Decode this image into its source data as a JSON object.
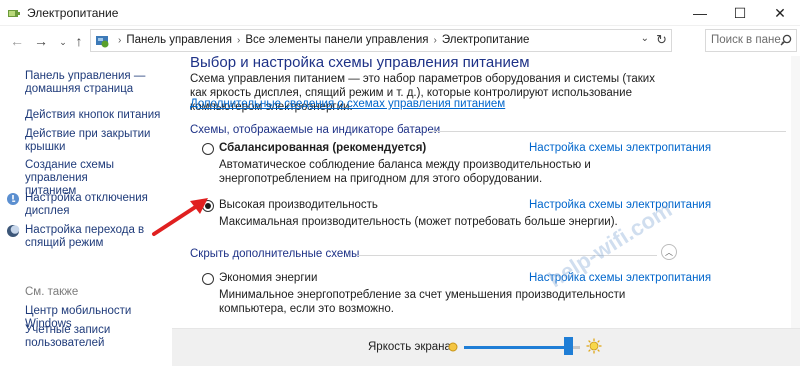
{
  "window": {
    "title": "Электропитание",
    "minimize": "—",
    "maximize": "☐",
    "close": "✕"
  },
  "nav": {
    "back": "←",
    "forward": "→",
    "dropdown": "⌄",
    "up": "↑",
    "breadcrumbs": [
      "Панель управления",
      "Все элементы панели управления",
      "Электропитание"
    ],
    "separator": "›",
    "address_drop": "⌄",
    "refresh": "↻",
    "search_placeholder": "Поиск в пане..."
  },
  "sidebar": {
    "home_line1": "Панель управления —",
    "home_line2": "домашняя страница",
    "items": [
      {
        "line1": "Действия кнопок питания",
        "line2": ""
      },
      {
        "line1": "Действие при закрытии",
        "line2": "крышки"
      },
      {
        "line1": "Создание схемы управления",
        "line2": "питанием"
      },
      {
        "line1": "Настройка отключения",
        "line2": "дисплея",
        "icon": "display-off-icon"
      },
      {
        "line1": "Настройка перехода в",
        "line2": "спящий режим",
        "icon": "sleep-moon-icon"
      }
    ],
    "see_also": "См. также",
    "see_also_items": [
      {
        "line1": "Центр мобильности Windows",
        "line2": ""
      },
      {
        "line1": "Учетные записи",
        "line2": "пользователей"
      }
    ]
  },
  "main": {
    "title": "Выбор и настройка схемы управления питанием",
    "description": "Схема управления питанием — это набор параметров оборудования и системы (таких как яркость дисплея, спящий режим и т. д.), которые контролируют использование компьютером электроэнергии.",
    "more_link": "Дополнительные сведения о схемах управления питанием",
    "group_battery": "Схемы, отображаемые на индикаторе батареи",
    "group_hidden": "Скрыть дополнительные схемы",
    "plans": [
      {
        "name": "Сбалансированная (рекомендуется)",
        "desc": "Автоматическое соблюдение баланса между производительностью и энергопотреблением на пригодном для этого оборудовании.",
        "link": "Настройка схемы электропитания",
        "checked": false
      },
      {
        "name": "Высокая производительность",
        "desc": "Максимальная производительность (может потребовать больше энергии).",
        "link": "Настройка схемы электропитания",
        "checked": true
      },
      {
        "name": "Экономия энергии",
        "desc": "Минимальное энергопотребление за счет уменьшения производительности компьютера, если это возможно.",
        "link": "Настройка схемы электропитания",
        "checked": false
      }
    ],
    "collapse_glyph": "︿"
  },
  "bottom": {
    "brightness_label": "Яркость экрана:",
    "brightness_level": 0.9
  },
  "watermark": "help-wifi.com",
  "colors": {
    "link": "#0066cc",
    "heading": "#1e3287",
    "slider": "#1f7ed6",
    "annotation_arrow": "#e02020"
  }
}
